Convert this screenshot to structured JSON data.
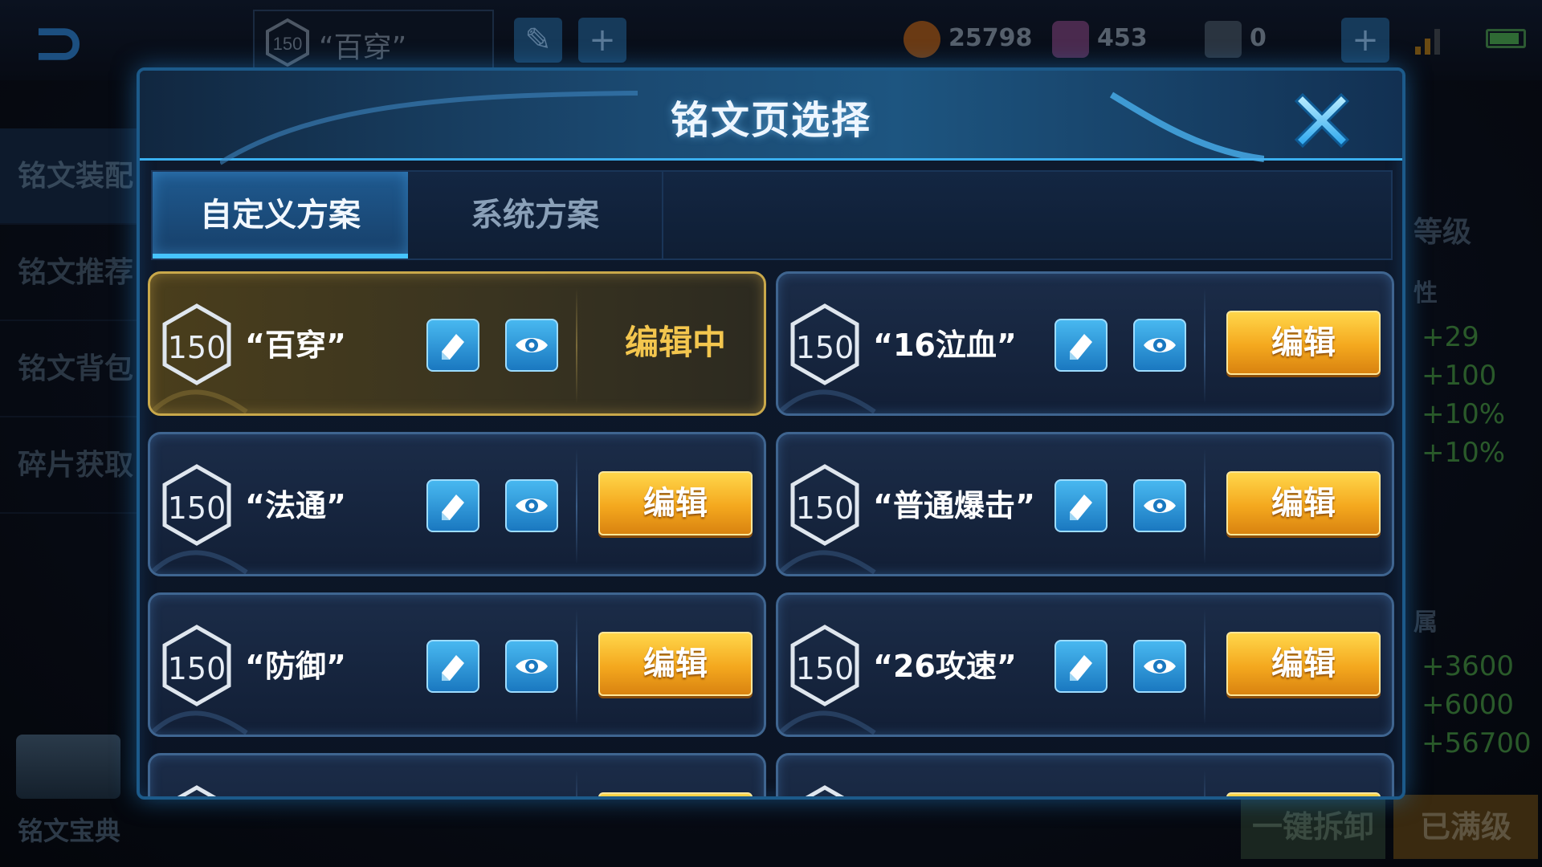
{
  "topbar": {
    "current_page_level": "150",
    "current_page_name": "“百穿”",
    "gold_amount": "25798",
    "diamond_amount": "453",
    "voucher_amount": "0",
    "add_label": "+"
  },
  "sidebar": {
    "items": [
      {
        "label": "铭文装配"
      },
      {
        "label": "铭文推荐"
      },
      {
        "label": "铭文背包"
      },
      {
        "label": "碎片获取"
      }
    ],
    "book_label": "铭文宝典"
  },
  "right_panel": {
    "level_heading": "等级",
    "attr_heading": "性",
    "stats_top": [
      "+29",
      "+100",
      "+10%",
      "+10%"
    ],
    "attr_heading_2": "属",
    "stats_bottom": [
      "+3600",
      "+6000",
      "+56700"
    ]
  },
  "bottom_buttons": {
    "disassemble": "一键拆卸",
    "maxed": "已满级"
  },
  "modal": {
    "title": "铭文页选择",
    "tabs": [
      {
        "label": "自定义方案",
        "active": true
      },
      {
        "label": "系统方案",
        "active": false
      }
    ],
    "pages": [
      {
        "level": "150",
        "name": "“百穿”",
        "status": "编辑中",
        "current": true
      },
      {
        "level": "150",
        "name": "“16泣血”",
        "action": "编辑",
        "current": false
      },
      {
        "level": "150",
        "name": "“法通”",
        "action": "编辑",
        "current": false
      },
      {
        "level": "150",
        "name": "“普通爆击”",
        "action": "编辑",
        "current": false
      },
      {
        "level": "150",
        "name": "“防御”",
        "action": "编辑",
        "current": false
      },
      {
        "level": "150",
        "name": "“26攻速”",
        "action": "编辑",
        "current": false
      }
    ]
  },
  "colors": {
    "accent_blue": "#46c4ff",
    "edit_button_orange": "#f4a81e",
    "current_card_gold": "#c9a84a"
  }
}
